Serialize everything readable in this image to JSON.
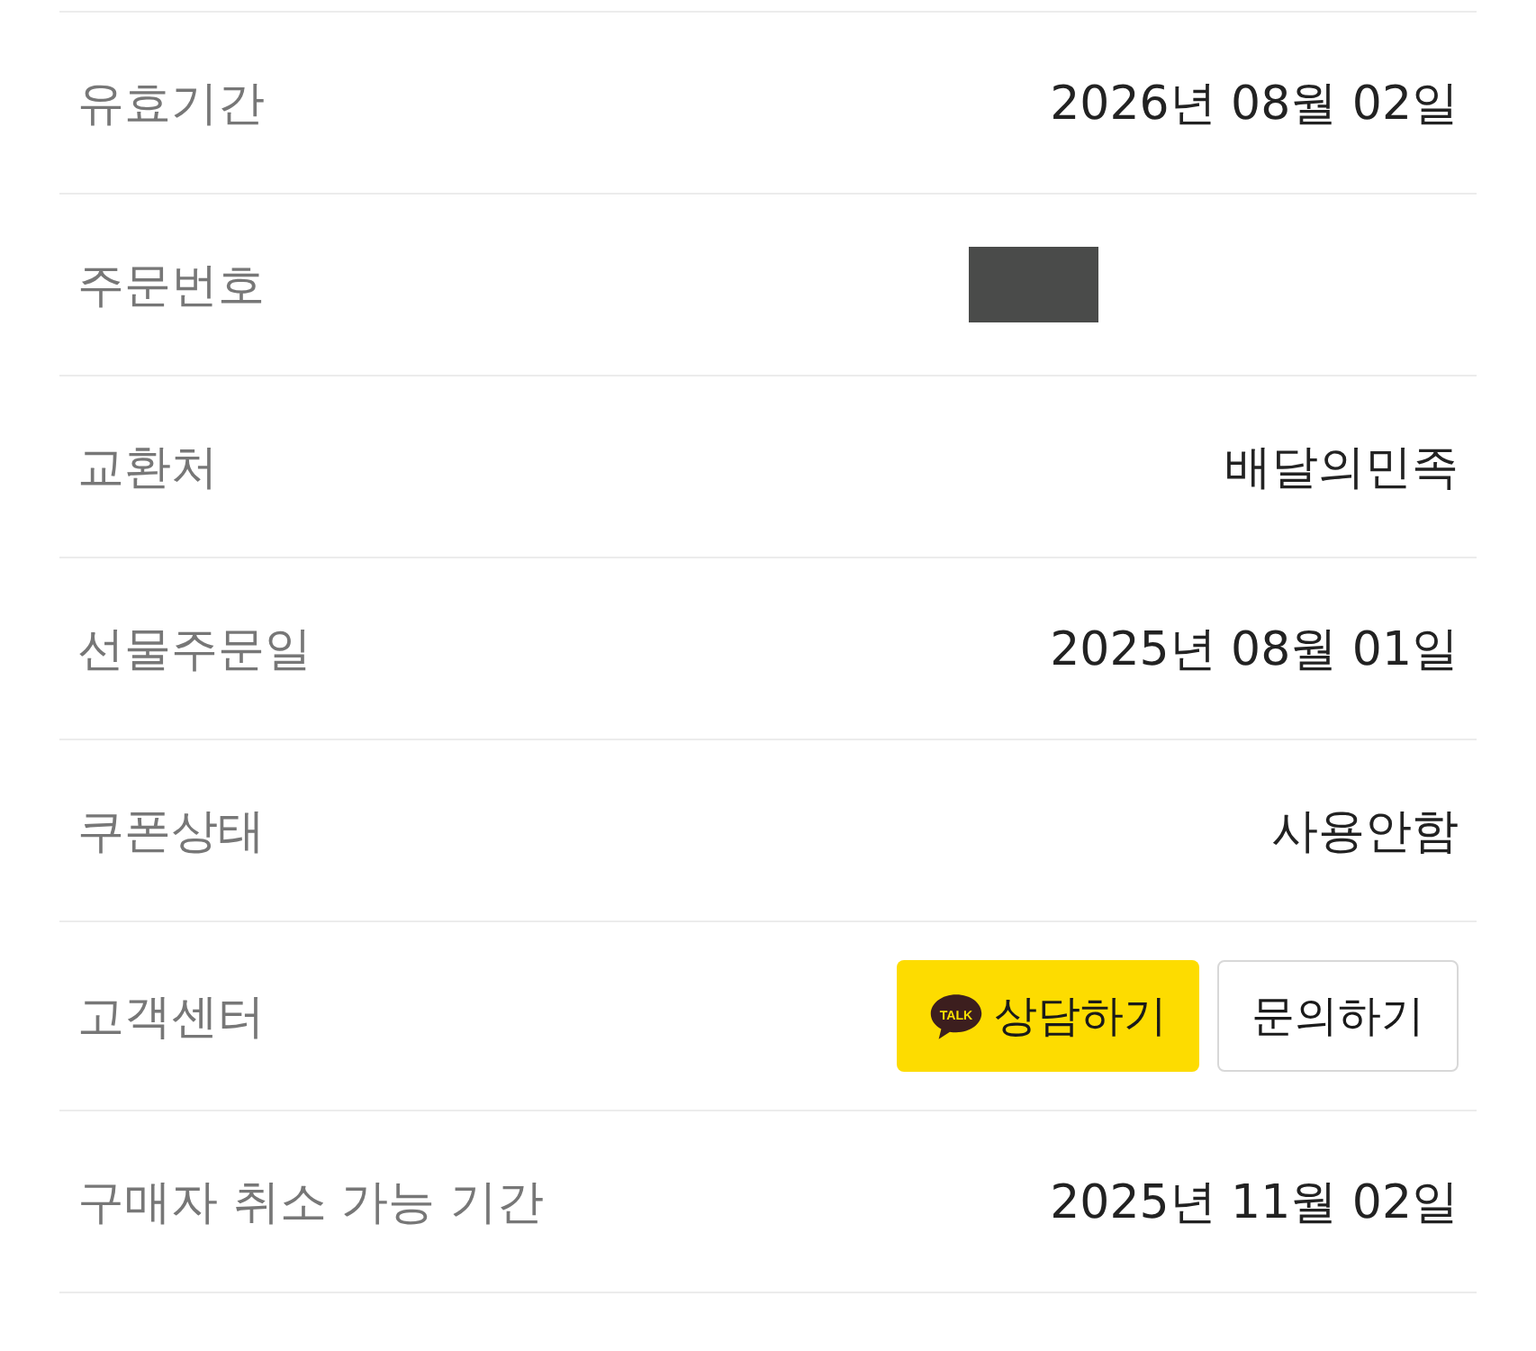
{
  "rows": [
    {
      "kind": "text",
      "label": "유효기간",
      "value": "2026년 08월 02일"
    },
    {
      "kind": "redacted",
      "label": "주문번호"
    },
    {
      "kind": "text",
      "label": "교환처",
      "value": "배달의민족"
    },
    {
      "kind": "text",
      "label": "선물주문일",
      "value": "2025년 08월 01일"
    },
    {
      "kind": "text",
      "label": "쿠폰상태",
      "value": "사용안함"
    },
    {
      "kind": "buttons",
      "label": "고객센터",
      "buttons": [
        {
          "kind": "talk",
          "label": "상담하기",
          "icon_text": "TALK"
        },
        {
          "kind": "plain",
          "label": "문의하기"
        }
      ]
    },
    {
      "kind": "text",
      "label": "구매자 취소 가능 기간",
      "value": "2025년 11월 02일"
    }
  ]
}
